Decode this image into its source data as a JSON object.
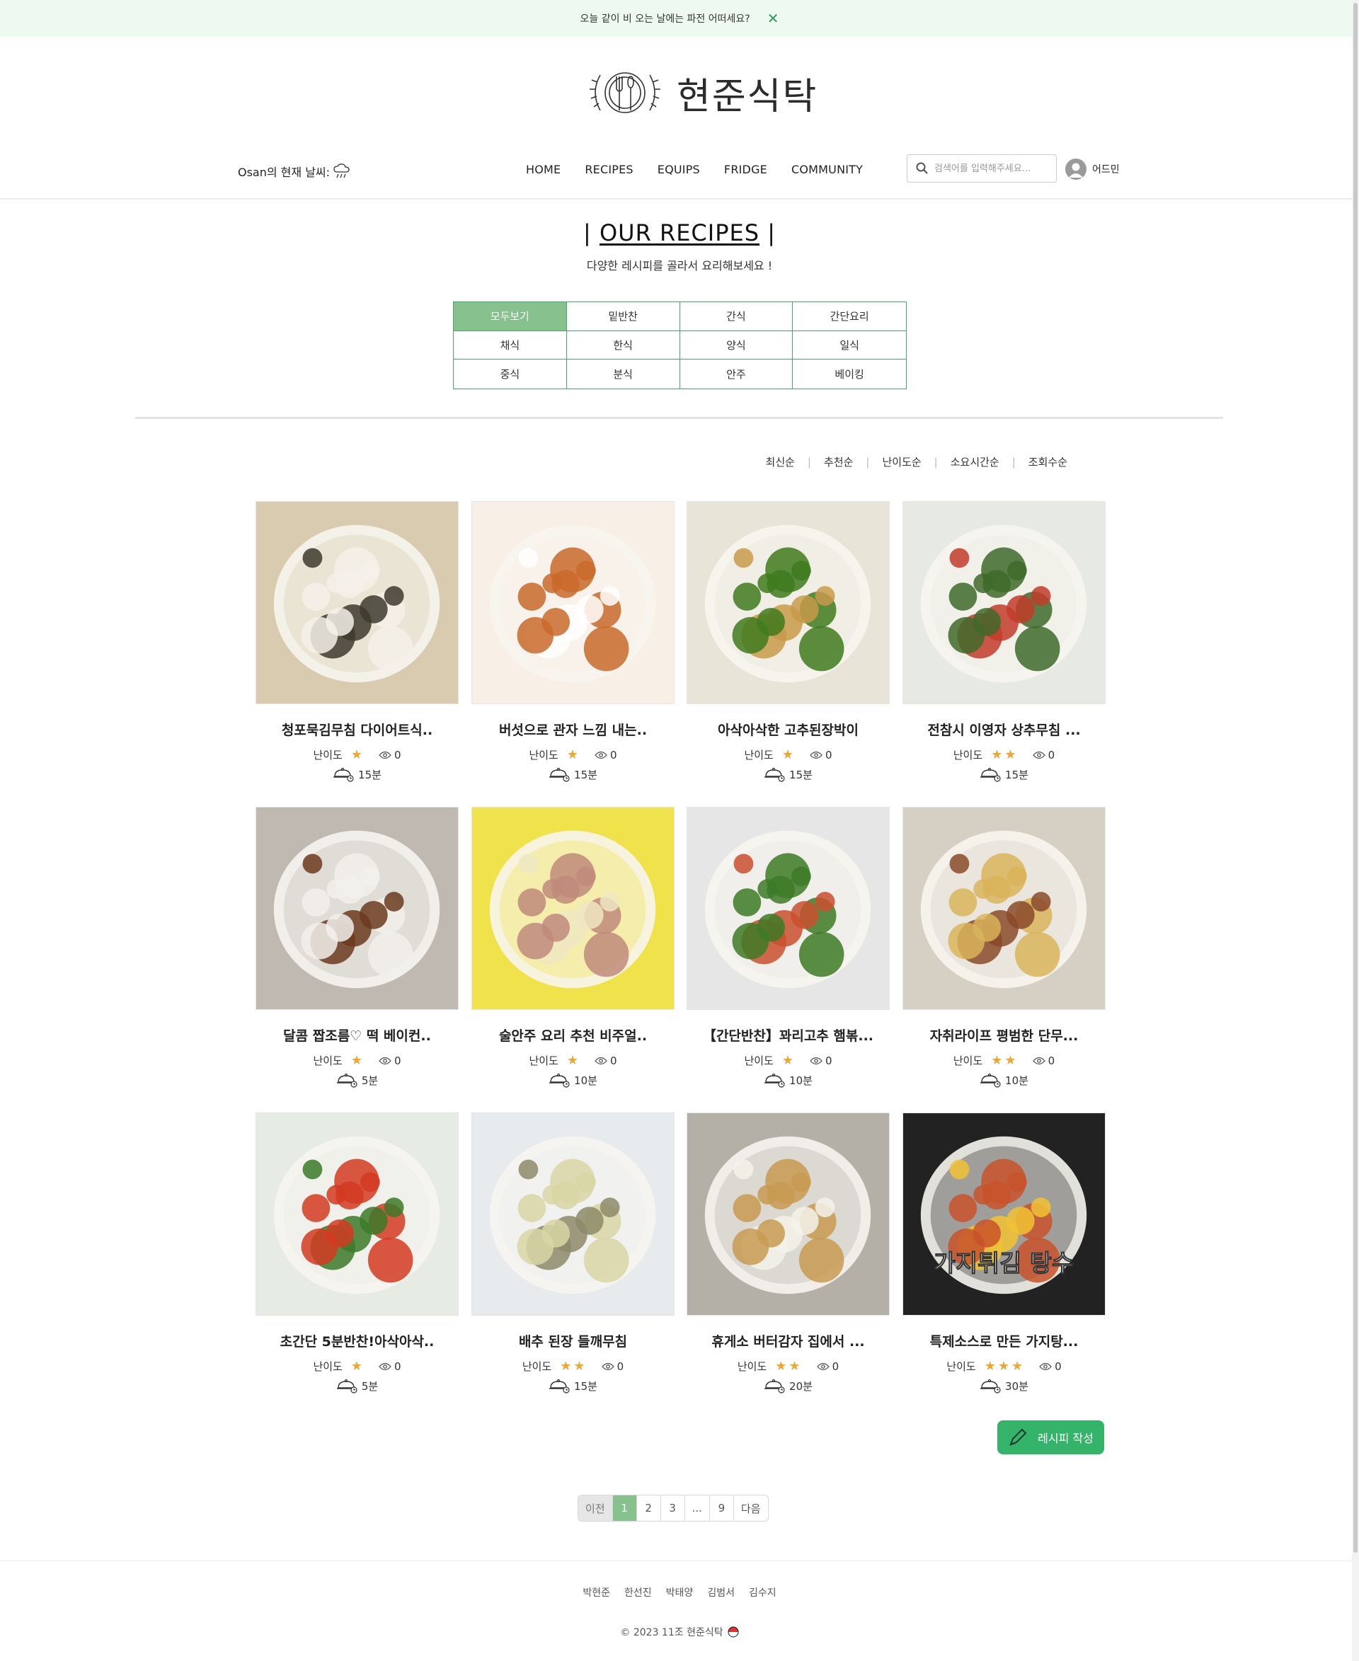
{
  "banner": {
    "text": "오늘 같이 비 오는 날에는 파전  어떠세요?",
    "close_icon": "close-icon"
  },
  "logo": {
    "text": "현준식탁",
    "icon": "plate-fork-spoon-icon"
  },
  "nav": {
    "weather_label": "Osan의 현재 날씨:",
    "weather_icon": "rain-cloud-icon",
    "menu": [
      "HOME",
      "RECIPES",
      "EQUIPS",
      "FRIDGE",
      "COMMUNITY"
    ],
    "search_placeholder": "검색어를 입력해주세요...",
    "user_name": "어드민"
  },
  "page": {
    "title_left": "| ",
    "title": "OUR RECIPES",
    "title_right": " |",
    "subtitle": "다양한 레시피를 골라서 요리해보세요 !"
  },
  "categories": [
    "모두보기",
    "밑반찬",
    "간식",
    "간단요리",
    "채식",
    "한식",
    "양식",
    "일식",
    "중식",
    "분식",
    "안주",
    "베이킹"
  ],
  "active_category": "모두보기",
  "sort_options": [
    "최신순",
    "추천순",
    "난이도순",
    "소요시간순",
    "조회수순"
  ],
  "recipes": [
    {
      "title": "청포묵김무침 다이어트식..",
      "difficulty": 1,
      "views": "0",
      "time": "15분",
      "colors": [
        "#d8cbb0",
        "#f4f1ea",
        "#3d3a2e"
      ]
    },
    {
      "title": "버섯으로 관자 느낌 내는..",
      "difficulty": 1,
      "views": "0",
      "time": "15분",
      "colors": [
        "#f8efe6",
        "#c96a2a",
        "#ffffff"
      ]
    },
    {
      "title": "아삭아삭한 고추된장박이",
      "difficulty": 1,
      "views": "0",
      "time": "15분",
      "colors": [
        "#e9e4d8",
        "#3f7a1e",
        "#c89a4a"
      ]
    },
    {
      "title": "전참시 이영자 상추무침 ...",
      "difficulty": 2,
      "views": "0",
      "time": "15분",
      "colors": [
        "#e7eae3",
        "#3f6a2a",
        "#c23b2a"
      ]
    },
    {
      "title": "달콤 짭조름♡ 떡 베이컨..",
      "difficulty": 1,
      "views": "0",
      "time": "5분",
      "colors": [
        "#bfb9b2",
        "#f2f0ec",
        "#6b3a20"
      ]
    },
    {
      "title": "술안주 요리 추천 비주얼..",
      "difficulty": 1,
      "views": "0",
      "time": "10분",
      "colors": [
        "#f0e24a",
        "#c08a7a",
        "#efe6c2"
      ]
    },
    {
      "title": "【간단반찬】꽈리고추 햄볶...",
      "difficulty": 1,
      "views": "0",
      "time": "10분",
      "colors": [
        "#e6e6e6",
        "#3d7a26",
        "#c9502e"
      ]
    },
    {
      "title": "자취라이프 평범한 단무...",
      "difficulty": 2,
      "views": "0",
      "time": "10분",
      "colors": [
        "#d6d0c4",
        "#d9b45a",
        "#8a4a2a"
      ]
    },
    {
      "title": "초간단 5분반찬!아삭아삭..",
      "difficulty": 1,
      "views": "0",
      "time": "5분",
      "colors": [
        "#e6ece4",
        "#d33a22",
        "#3c7a2a"
      ]
    },
    {
      "title": "배추 된장 들깨무침",
      "difficulty": 2,
      "views": "0",
      "time": "15분",
      "colors": [
        "#e7ebee",
        "#d9d6a6",
        "#8d8a6a"
      ]
    },
    {
      "title": "휴게소 버터감자 집에서 ...",
      "difficulty": 2,
      "views": "0",
      "time": "20분",
      "colors": [
        "#b4b0a8",
        "#c89b52",
        "#f4f2ea"
      ]
    },
    {
      "title": "특제소스로 만든 가지탕...",
      "difficulty": 3,
      "views": "0",
      "time": "30분",
      "colors": [
        "#222222",
        "#c8522a",
        "#f1c232"
      ],
      "overlay": "가지튀김 탕수"
    }
  ],
  "labels": {
    "difficulty": "난이도",
    "write": "레시피 작성"
  },
  "pagination": [
    "이전",
    "1",
    "2",
    "3",
    "...",
    "9",
    "다음"
  ],
  "current_page": "1",
  "footer": {
    "names": [
      "박현준",
      "한선진",
      "박태양",
      "김범서",
      "김수지"
    ],
    "copyright": "© 2023 11조 현준식탁"
  }
}
